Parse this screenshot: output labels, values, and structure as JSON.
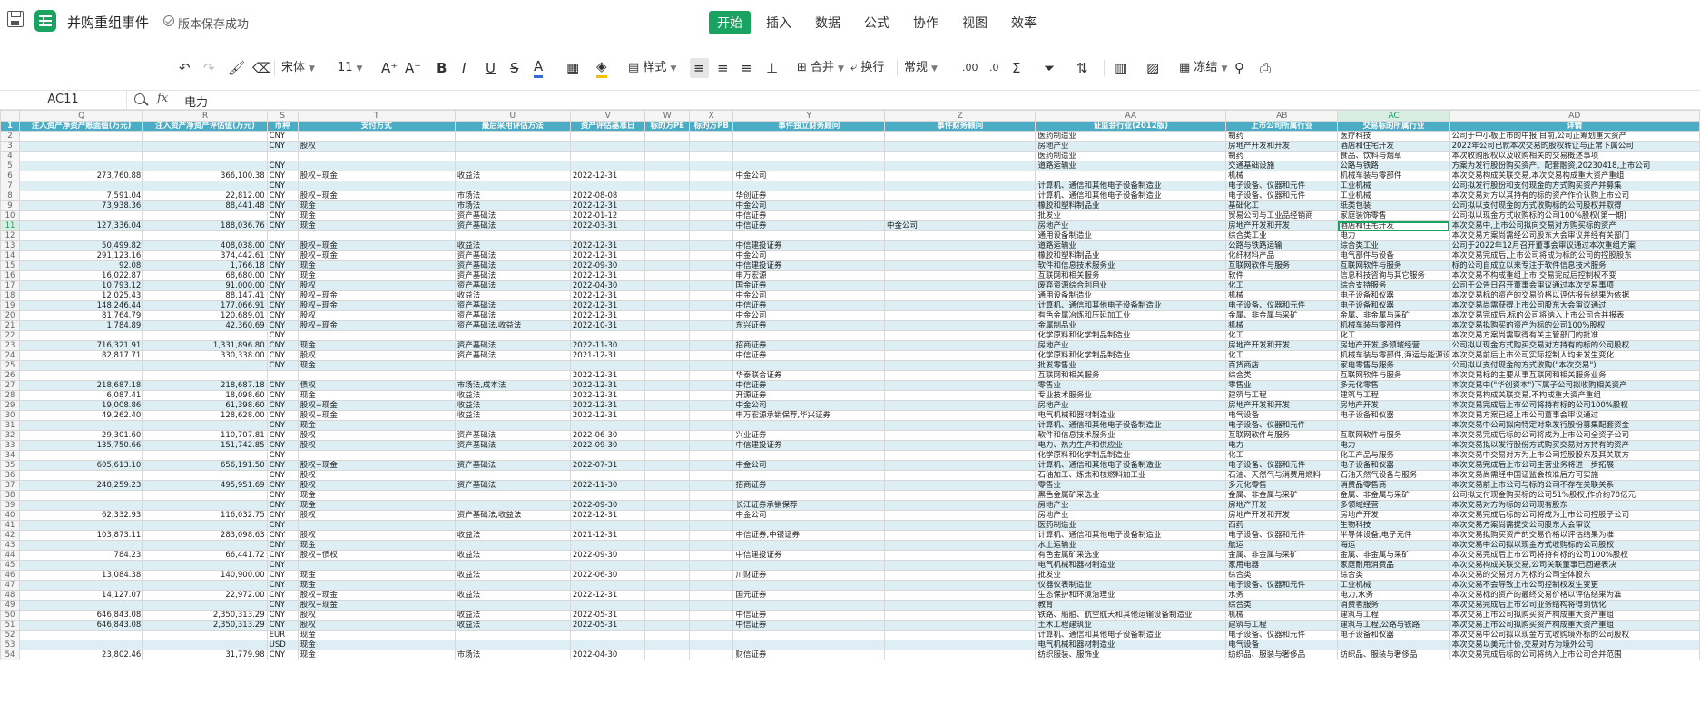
{
  "title": {
    "doc_name": "并购重组事件",
    "save_status": "版本保存成功"
  },
  "menu": {
    "tabs": [
      "开始",
      "插入",
      "数据",
      "公式",
      "协作",
      "视图",
      "效率"
    ],
    "active": "开始"
  },
  "toolbar": {
    "font": "宋体",
    "size": "11",
    "style_label": "样式",
    "merge_label": "合并",
    "wrap_label": "换行",
    "format": "常规",
    "freeze_label": "冻结"
  },
  "formula_bar": {
    "cell_ref": "AC11",
    "fx": "fx",
    "value": "电力"
  },
  "grid": {
    "col_letters": [
      "Q",
      "R",
      "S",
      "T",
      "U",
      "V",
      "W",
      "X",
      "Y",
      "Z",
      "AA",
      "AB",
      "AC",
      "AD"
    ],
    "headers": [
      "注入资产净资产账面值(万元)",
      "注入资产净资产评估值(万元)",
      "币种",
      "支付方式",
      "最后采用评估方法",
      "资产评估基准日",
      "标的方PE",
      "标的方PB",
      "事件独立财务顾问",
      "事件财务顾问",
      "证监会行业(2012版)",
      "上市公司所属行业",
      "交易标的所属行业",
      "详情"
    ],
    "rows": [
      [
        "",
        "",
        "CNY",
        "",
        "",
        "",
        "",
        "",
        "",
        "",
        "医药制造业",
        "制药",
        "医疗科技",
        "公司于中小板上市的中报,目前,公司正筹划重大资产"
      ],
      [
        "",
        "",
        "CNY",
        "股权",
        "",
        "",
        "",
        "",
        "",
        "",
        "房地产业",
        "房地产开发和开发",
        "酒店和住宅开发",
        "2022年公司已就本次交易的股权转让与正常下属公司"
      ],
      [
        "",
        "",
        "",
        "",
        "",
        "",
        "",
        "",
        "",
        "",
        "医药制造业",
        "制药",
        "食品、饮料与烟草",
        "本次收购股权以及收购相关的交易概述事项"
      ],
      [
        "",
        "",
        "CNY",
        "",
        "",
        "",
        "",
        "",
        "",
        "",
        "道路运输业",
        "交通基础设施",
        "公路与铁路",
        "方案为发行股份购买资产、配套融资,20230418,上市公司"
      ],
      [
        "273,760.88",
        "366,100.38",
        "CNY",
        "股权+现金",
        "收益法",
        "2022-12-31",
        "",
        "",
        "中金公司",
        "",
        "",
        "机械",
        "机械车装与零部件",
        "本次交易构成关联交易,本次交易构成重大资产重组"
      ],
      [
        "",
        "",
        "CNY",
        "",
        "",
        "",
        "",
        "",
        "",
        "",
        "计算机、通信和其他电子设备制造业",
        "电子设备、仪器和元件",
        "工业机械",
        "公司拟发行股份和支付现金的方式购买资产并募集"
      ],
      [
        "7,591.04",
        "22,812.00",
        "CNY",
        "股权+现金",
        "市场法",
        "2022-08-08",
        "",
        "",
        "华创证券",
        "",
        "计算机、通信和其他电子设备制造业",
        "电子设备、仪器和元件",
        "工业机械",
        "本次交易对方以其持有的标的资产作价认购上市公司"
      ],
      [
        "73,938.36",
        "88,441.48",
        "CNY",
        "现金",
        "市场法",
        "2022-12-31",
        "",
        "",
        "中金公司",
        "",
        "橡胶和塑料制品业",
        "基础化工",
        "纸类包装",
        "公司拟以支付现金的方式收购标的公司股权并取得"
      ],
      [
        "",
        "",
        "CNY",
        "现金",
        "资产基础法",
        "2022-01-12",
        "",
        "",
        "中信证券",
        "",
        "批发业",
        "贸易公司与工业品经销商",
        "家庭装饰零售",
        "公司拟以现金方式收购标的公司100%股权(第一期)"
      ],
      [
        "127,336.04",
        "188,036.76",
        "CNY",
        "现金",
        "资产基础法",
        "2022-03-31",
        "",
        "",
        "中信证券",
        "中金公司",
        "房地产业",
        "房地产开发和开发",
        "酒店和住宅开发",
        "本次交易中,上市公司拟向交易对方购买标的资产"
      ],
      [
        "",
        "",
        "",
        "",
        "",
        "",
        "",
        "",
        "",
        "",
        "通用设备制造业",
        "综合类工业",
        "电力",
        "本次交易方案尚需经公司股东大会审议并经有关部门"
      ],
      [
        "50,499.82",
        "408,038.00",
        "CNY",
        "股权+现金",
        "收益法",
        "2022-12-31",
        "",
        "",
        "中信建投证券",
        "",
        "道路运输业",
        "公路与铁路运输",
        "综合类工业",
        "公司于2022年12月召开董事会审议通过本次重组方案"
      ],
      [
        "291,123.16",
        "374,442.61",
        "CNY",
        "股权+现金",
        "资产基础法",
        "2022-12-31",
        "",
        "",
        "中金公司",
        "",
        "橡胶和塑料制品业",
        "化纤材料产品",
        "电气部件与设备",
        "本次交易完成后,上市公司将成为标的公司的控股股东"
      ],
      [
        "92.08",
        "1,766.18",
        "CNY",
        "现金",
        "资产基础法",
        "2022-09-30",
        "",
        "",
        "中信建投证券",
        "",
        "软件和信息技术服务业",
        "互联网软件与服务",
        "互联网软件与服务",
        "标的公司自成立以来专注于软件信息技术服务"
      ],
      [
        "16,022.87",
        "68,680.00",
        "CNY",
        "现金",
        "资产基础法",
        "2022-12-31",
        "",
        "",
        "申万宏源",
        "",
        "互联网和相关服务",
        "软件",
        "信息科技咨询与其它服务",
        "本次交易不构成重组上市,交易完成后控制权不变"
      ],
      [
        "10,793.12",
        "91,000.00",
        "CNY",
        "股权",
        "资产基础法",
        "2022-04-30",
        "",
        "",
        "国金证券",
        "",
        "废弃资源综合利用业",
        "化工",
        "综合支持服务",
        "公司于公告日召开董事会审议通过本次交易事项"
      ],
      [
        "12,025.43",
        "88,147.41",
        "CNY",
        "股权+现金",
        "收益法",
        "2022-12-31",
        "",
        "",
        "中金公司",
        "",
        "通用设备制造业",
        "机械",
        "电子设备和仪器",
        "本次交易标的资产的交易价格以评估报告结果为依据"
      ],
      [
        "148,246.44",
        "177,066.91",
        "CNY",
        "股权+现金",
        "资产基础法",
        "2022-12-31",
        "",
        "",
        "中信证券",
        "",
        "计算机、通信和其他电子设备制造业",
        "电子设备、仪器和元件",
        "电子设备和仪器",
        "本次交易尚需获得上市公司股东大会审议通过"
      ],
      [
        "81,764.79",
        "120,689.01",
        "CNY",
        "股权",
        "资产基础法",
        "2022-12-31",
        "",
        "",
        "中金公司",
        "",
        "有色金属冶炼和压延加工业",
        "金属、非金属与采矿",
        "金属、非金属与采矿",
        "本次交易完成后,标的公司将纳入上市公司合并报表"
      ],
      [
        "1,784.89",
        "42,360.69",
        "CNY",
        "股权+现金",
        "资产基础法,收益法",
        "2022-10-31",
        "",
        "",
        "东兴证券",
        "",
        "金属制品业",
        "机械",
        "机械车装与零部件",
        "本次交易拟购买的资产为标的公司100%股权"
      ],
      [
        "",
        "",
        "CNY",
        "",
        "",
        "",
        "",
        "",
        "",
        "",
        "化学原料和化学制品制造业",
        "化工",
        "化工",
        "本次交易方案尚需取得有关主管部门的批准"
      ],
      [
        "716,321.91",
        "1,331,896.80",
        "CNY",
        "现金",
        "资产基础法",
        "2022-11-30",
        "",
        "",
        "招商证券",
        "",
        "房地产业",
        "房地产开发和开发",
        "房地产开发,多领域经营",
        "公司拟以现金方式购买交易对方持有的标的公司股权"
      ],
      [
        "82,817.71",
        "330,338.00",
        "CNY",
        "股权",
        "资产基础法",
        "2021-12-31",
        "",
        "",
        "中信证券",
        "",
        "化学原料和化学制品制造业",
        "化工",
        "机械车装与零部件,海运与能源设备与服务",
        "本次交易前后上市公司实际控制人均未发生变化"
      ],
      [
        "",
        "",
        "CNY",
        "现金",
        "",
        "",
        "",
        "",
        "",
        "",
        "批发零售业",
        "百货商店",
        "家电零售与服务",
        "公司拟以支付现金的方式收购(\"本次交易\")"
      ],
      [
        "",
        "",
        "",
        "",
        "",
        "2022-12-31",
        "",
        "",
        "华泰联合证券",
        "",
        "互联网和相关服务",
        "综合类",
        "互联网软件与服务",
        "本次交易标的主要从事互联网和相关服务业务"
      ],
      [
        "218,687.18",
        "218,687.18",
        "CNY",
        "债权",
        "市场法,成本法",
        "2022-12-31",
        "",
        "",
        "中信证券",
        "",
        "零售业",
        "零售业",
        "多元化零售",
        "本次交易中(\"华创资本\")下属子公司拟收购相关资产"
      ],
      [
        "6,087.41",
        "18,098.60",
        "CNY",
        "现金",
        "收益法",
        "2022-12-31",
        "",
        "",
        "开源证券",
        "",
        "专业技术服务业",
        "建筑与工程",
        "建筑与工程",
        "本次交易构成关联交易,不构成重大资产重组"
      ],
      [
        "19,008.86",
        "61,398.60",
        "CNY",
        "股权+现金",
        "收益法",
        "2022-12-31",
        "",
        "",
        "中金公司",
        "",
        "房地产业",
        "房地产开发和开发",
        "房地产开发",
        "本次交易完成后上市公司将持有标的公司100%股权"
      ],
      [
        "49,262.40",
        "128,628.00",
        "CNY",
        "股权+现金",
        "收益法",
        "2022-12-31",
        "",
        "",
        "申万宏源承销保荐,华兴证券",
        "",
        "电气机械和器材制造业",
        "电气设备",
        "电子设备和仪器",
        "本次交易方案已经上市公司董事会审议通过"
      ],
      [
        "",
        "",
        "CNY",
        "现金",
        "",
        "",
        "",
        "",
        "",
        "",
        "计算机、通信和其他电子设备制造业",
        "电子设备、仪器和元件",
        "",
        "本次交易中公司拟向特定对象发行股份募集配套资金"
      ],
      [
        "29,301.60",
        "110,707.81",
        "CNY",
        "股权",
        "资产基础法",
        "2022-06-30",
        "",
        "",
        "兴业证券",
        "",
        "软件和信息技术服务业",
        "互联网软件与服务",
        "互联网软件与服务",
        "本次交易完成后标的公司将成为上市公司全资子公司"
      ],
      [
        "135,750.66",
        "151,742.85",
        "CNY",
        "股权",
        "资产基础法",
        "2022-09-30",
        "",
        "",
        "中信建投证券",
        "",
        "电力、热力生产和供应业",
        "电力",
        "电力",
        "本次交易拟以发行股份方式购买交易对方持有的资产"
      ],
      [
        "",
        "",
        "CNY",
        "",
        "",
        "",
        "",
        "",
        "",
        "",
        "化学原料和化学制品制造业",
        "化工",
        "化工产品与服务",
        "本次交易中交易对方为上市公司控股股东及其关联方"
      ],
      [
        "605,613.10",
        "656,191.50",
        "CNY",
        "股权+现金",
        "资产基础法",
        "2022-07-31",
        "",
        "",
        "中金公司",
        "",
        "计算机、通信和其他电子设备制造业",
        "电子设备、仪器和元件",
        "电子设备和仪器",
        "本次交易完成后上市公司主营业务将进一步拓展"
      ],
      [
        "",
        "",
        "CNY",
        "股权",
        "",
        "",
        "",
        "",
        "",
        "",
        "石油加工、炼焦和核燃料加工业",
        "石油、天然气与消费用燃料",
        "石油天然气设备与服务",
        "本次交易尚需经中国证监会核准后方可实施"
      ],
      [
        "248,259.23",
        "495,951.69",
        "CNY",
        "股权",
        "资产基础法",
        "2022-11-30",
        "",
        "",
        "招商证券",
        "",
        "零售业",
        "多元化零售",
        "消费品零售商",
        "本次交易前上市公司与标的公司不存在关联关系"
      ],
      [
        "",
        "",
        "CNY",
        "现金",
        "",
        "",
        "",
        "",
        "",
        "",
        "黑色金属矿采选业",
        "金属、非金属与采矿",
        "金属、非金属与采矿",
        "公司拟支付现金购买标的公司51%股权,作价约78亿元"
      ],
      [
        "",
        "",
        "CNY",
        "现金",
        "",
        "2022-09-30",
        "",
        "",
        "长江证券承销保荐",
        "",
        "房地产业",
        "房地产开发",
        "多领域经营",
        "本次交易对方为标的公司现有股东"
      ],
      [
        "62,332.93",
        "116,032.75",
        "CNY",
        "股权",
        "资产基础法,收益法",
        "2022-12-31",
        "",
        "",
        "中金公司",
        "",
        "房地产业",
        "房地产开发和开发",
        "房地产开发",
        "本次交易完成后标的公司将成为上市公司控股子公司"
      ],
      [
        "",
        "",
        "CNY",
        "",
        "",
        "",
        "",
        "",
        "",
        "",
        "医药制造业",
        "西药",
        "生物科技",
        "本次交易方案尚需提交公司股东大会审议"
      ],
      [
        "103,873.11",
        "283,098.63",
        "CNY",
        "股权",
        "收益法",
        "2021-12-31",
        "",
        "",
        "中信证券,中银证券",
        "",
        "计算机、通信和其他电子设备制造业",
        "电子设备、仪器和元件",
        "半导体设备,电子元件",
        "本次交易拟购买资产的交易价格以评估结果为准"
      ],
      [
        "",
        "",
        "CNY",
        "现金",
        "",
        "",
        "",
        "",
        "",
        "",
        "水上运输业",
        "航运",
        "海运",
        "本次交易中公司拟以现金方式收购标的公司股权"
      ],
      [
        "784.23",
        "66,441.72",
        "CNY",
        "股权+债权",
        "收益法",
        "2022-09-30",
        "",
        "",
        "中信建投证券",
        "",
        "有色金属矿采选业",
        "金属、非金属与采矿",
        "金属、非金属与采矿",
        "本次交易完成后上市公司将持有标的公司100%股权"
      ],
      [
        "",
        "",
        "CNY",
        "",
        "",
        "",
        "",
        "",
        "",
        "",
        "电气机械和器材制造业",
        "家用电器",
        "家庭耐用消费品",
        "本次交易构成关联交易,公司关联董事已回避表决"
      ],
      [
        "13,084.38",
        "140,900.00",
        "CNY",
        "现金",
        "收益法",
        "2022-06-30",
        "",
        "",
        "川财证券",
        "",
        "批发业",
        "综合类",
        "综合类",
        "本次交易的交易对方为标的公司全体股东"
      ],
      [
        "",
        "",
        "CNY",
        "现金",
        "",
        "",
        "",
        "",
        "",
        "",
        "仪器仪表制造业",
        "电子设备、仪器和元件",
        "工业机械",
        "本次交易不会导致上市公司控制权发生变更"
      ],
      [
        "14,127.07",
        "22,972.00",
        "CNY",
        "股权+现金",
        "收益法",
        "2022-12-31",
        "",
        "",
        "国元证券",
        "",
        "生态保护和环境治理业",
        "水务",
        "电力,水务",
        "本次交易标的资产的最终交易价格以评估结果为准"
      ],
      [
        "",
        "",
        "CNY",
        "股权+现金",
        "",
        "",
        "",
        "",
        "",
        "",
        "教育",
        "综合类",
        "消费者服务",
        "本次交易完成后上市公司业务结构将得到优化"
      ],
      [
        "646,843.08",
        "2,350,313.29",
        "CNY",
        "股权",
        "收益法",
        "2022-05-31",
        "",
        "",
        "中信证券",
        "",
        "铁路、船舶、航空航天和其他运输设备制造业",
        "机械",
        "建筑与工程",
        "本次交易上市公司拟购买资产构成重大资产重组"
      ],
      [
        "646,843.08",
        "2,350,313.29",
        "CNY",
        "股权",
        "收益法",
        "2022-05-31",
        "",
        "",
        "中信证券",
        "",
        "土木工程建筑业",
        "建筑与工程",
        "建筑与工程,公路与铁路",
        "本次交易上市公司拟购买资产构成重大资产重组"
      ],
      [
        "",
        "",
        "EUR",
        "现金",
        "",
        "",
        "",
        "",
        "",
        "",
        "计算机、通信和其他电子设备制造业",
        "电子设备、仪器和元件",
        "电子设备和仪器",
        "本次交易中公司拟以现金方式收购境外标的公司股权"
      ],
      [
        "",
        "",
        "USD",
        "现金",
        "",
        "",
        "",
        "",
        "",
        "",
        "电气机械和器材制造业",
        "电气设备",
        "",
        "本次交易以美元计价,交易对方为境外公司"
      ],
      [
        "23,802.46",
        "31,779.98",
        "CNY",
        "现金",
        "市场法",
        "2022-04-30",
        "",
        "",
        "财信证券",
        "",
        "纺织服装、服饰业",
        "纺织品、服装与奢侈品",
        "纺织品、服装与奢侈品",
        "本次交易完成后标的公司将纳入上市公司合并范围"
      ]
    ]
  }
}
